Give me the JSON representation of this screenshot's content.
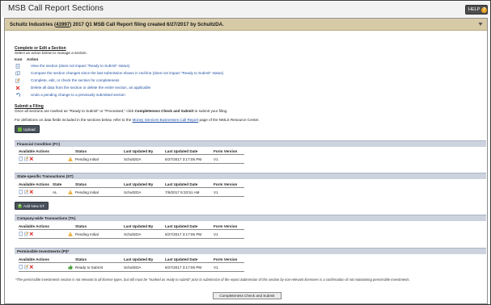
{
  "app": {
    "title": "MSB Call Report Sections",
    "help_label": "HELP",
    "help_glyph": "?"
  },
  "report": {
    "header_prefix": "Schultz Industries (",
    "header_link": "43997",
    "header_suffix": ") 2017 Q1 MSB Call Report filing created 6/27/2017 by SchultzDA."
  },
  "manage": {
    "heading": "Complete or Edit a Section",
    "intro": "Select an action below to manage a section.",
    "col_icon": "Icon",
    "col_action": "Action",
    "actions": [
      {
        "icon": "view-icon",
        "text": "View the section (does not impact \"Ready to Submit\" status)"
      },
      {
        "icon": "compare-icon",
        "text": "Compare the section changes since the last submission shown in red-line (does not impact \"Ready to Submit\" status)"
      },
      {
        "icon": "edit-icon",
        "text": "Complete, edit, or check the section for completeness"
      },
      {
        "icon": "delete-icon",
        "text": "Delete all data from the section or delete the entire section, as applicable"
      },
      {
        "icon": "undo-icon",
        "text": "Undo a pending change to a previously submitted section"
      }
    ]
  },
  "submit": {
    "heading": "Submit a Filing",
    "line1_a": "Once all sections are marked as \"Ready to Submit\" or \"Processed,\" click ",
    "line1_b": "Completeness Check and Submit",
    "line1_c": " to submit your filing.",
    "line2_a": "For definitions on data fields included in the sections below, refer to the ",
    "line2_link": "Money Services Businesses Call Report",
    "line2_c": " page of the NMLS Resource Center.",
    "upload_label": "Upload"
  },
  "sections": [
    {
      "title": "Financial Condition (FC)",
      "headers": [
        "Available Actions",
        "Status",
        "Last Updated By",
        "Last Updated Date",
        "Form Version"
      ],
      "row": {
        "status": "Pending Initial",
        "by": "SchultzDA",
        "date": "6/27/2017 3:17:05 PM",
        "version": "V1"
      }
    },
    {
      "title": "State-specific Transactions (ST)",
      "headers": [
        "Available Actions",
        "State",
        "Status",
        "Last Updated By",
        "Last Updated Date",
        "Form Version"
      ],
      "row": {
        "state": "AL",
        "status": "Pending Initial",
        "by": "SchultzDA",
        "date": "7/6/2017 9:33:51 AM",
        "version": "V1"
      },
      "add_label": "Add New ST"
    },
    {
      "title": "Company-wide Transactions (TA)",
      "headers": [
        "Available Actions",
        "Status",
        "Last Updated By",
        "Last Updated Date",
        "Form Version"
      ],
      "row": {
        "status": "Pending Initial",
        "by": "SchultzDA",
        "date": "6/27/2017 3:17:05 PM",
        "version": "V1"
      }
    },
    {
      "title": "Permissible Investments (PI)*",
      "headers": [
        "Available Actions",
        "Status",
        "Last Updated By",
        "Last Updated Date",
        "Form Version"
      ],
      "row": {
        "status": "Ready to Submit",
        "by": "SchultzDA",
        "date": "6/27/2017 3:17:06 PM",
        "version": "V1"
      }
    }
  ],
  "footnote": "*The permissible investments section is not relevant to all license types, but still must be \"marked as ready to submit\" prior to submission of the report.Submission of this section by non-relevant licensees is a confirmation of not maintaining permissible investments.",
  "complete_button": "Completeness Check and Submit",
  "colors": {
    "header_band": "#d7caa7",
    "section_bar": "#cdd3de",
    "button_dark": "#49515d",
    "link_blue": "#1f4fa3",
    "warning": "#e8a524",
    "ready_green": "#3d9a2f"
  }
}
